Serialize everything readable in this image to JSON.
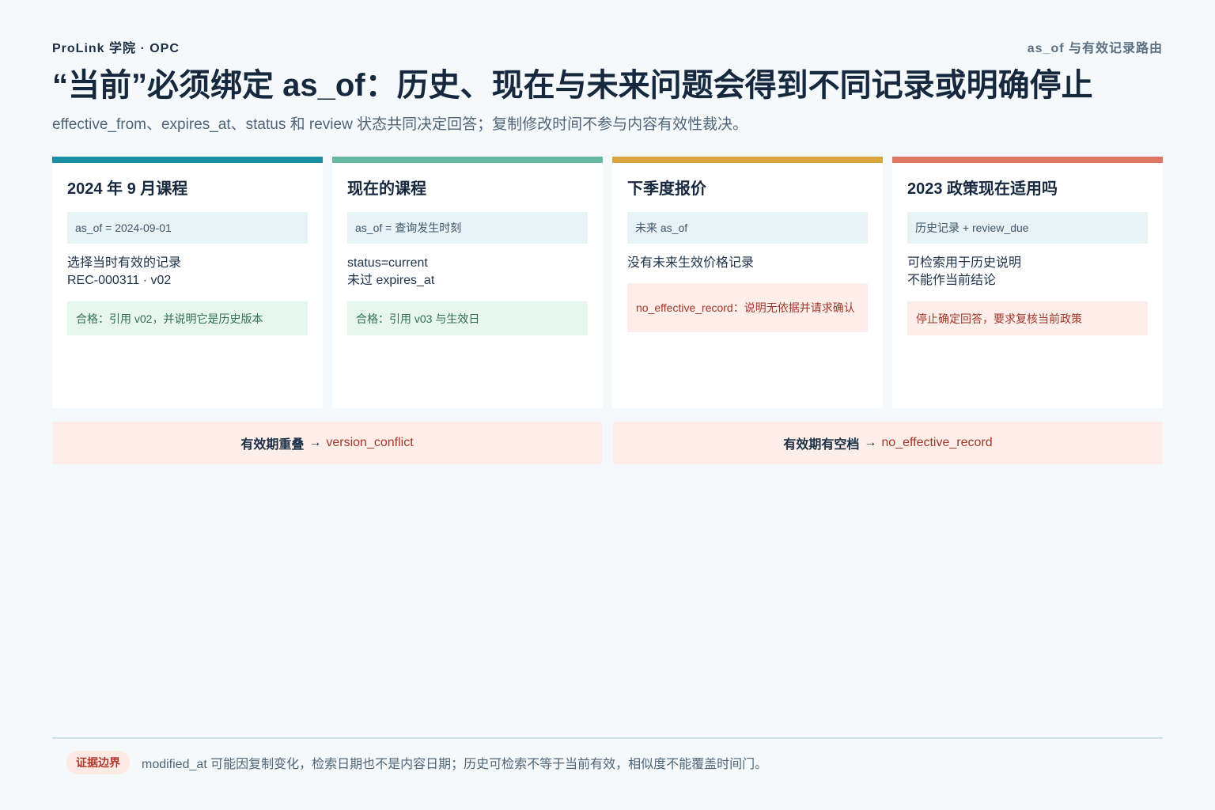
{
  "header": {
    "brand": "ProLink 学院 · OPC",
    "topic": "as_of 与有效记录路由",
    "title": "“当前”必须绑定 as_of：历史、现在与未来问题会得到不同记录或明确停止",
    "subtitle": "effective_from、expires_at、status 和 review 状态共同决定回答；复制修改时间不参与内容有效性裁决。"
  },
  "cards": [
    {
      "title": "2024 年 9 月课程",
      "condition": "as_of = 2024-09-01",
      "desc": [
        "选择当时有效的记录",
        "REC-000311 · v02"
      ],
      "result": "合格：引用 v02，并说明它是历史版本",
      "result_kind": "ok"
    },
    {
      "title": "现在的课程",
      "condition": "as_of = 查询发生时刻",
      "desc": [
        "status=current",
        "未过 expires_at"
      ],
      "result": "合格：引用 v03 与生效日",
      "result_kind": "ok"
    },
    {
      "title": "下季度报价",
      "condition": "未来 as_of",
      "desc": [
        "没有未来生效价格记录"
      ],
      "result": "no_effective_record：说明无依据并请求确认",
      "result_kind": "stop"
    },
    {
      "title": "2023 政策现在适用吗",
      "condition": "历史记录 + review_due",
      "desc": [
        "可检索用于历史说明",
        "不能作当前结论"
      ],
      "result": "停止确定回答，要求复核当前政策",
      "result_kind": "stop"
    }
  ],
  "rules": [
    {
      "name": "有效期重叠",
      "arrow": "→",
      "code": "version_conflict"
    },
    {
      "name": "有效期有空档",
      "arrow": "→",
      "code": "no_effective_record"
    }
  ],
  "footer": {
    "badge": "证据边界",
    "note": "modified_at 可能因复制变化，检索日期也不是内容日期；历史可检索不等于当前有效，相似度不能覆盖时间门。"
  }
}
